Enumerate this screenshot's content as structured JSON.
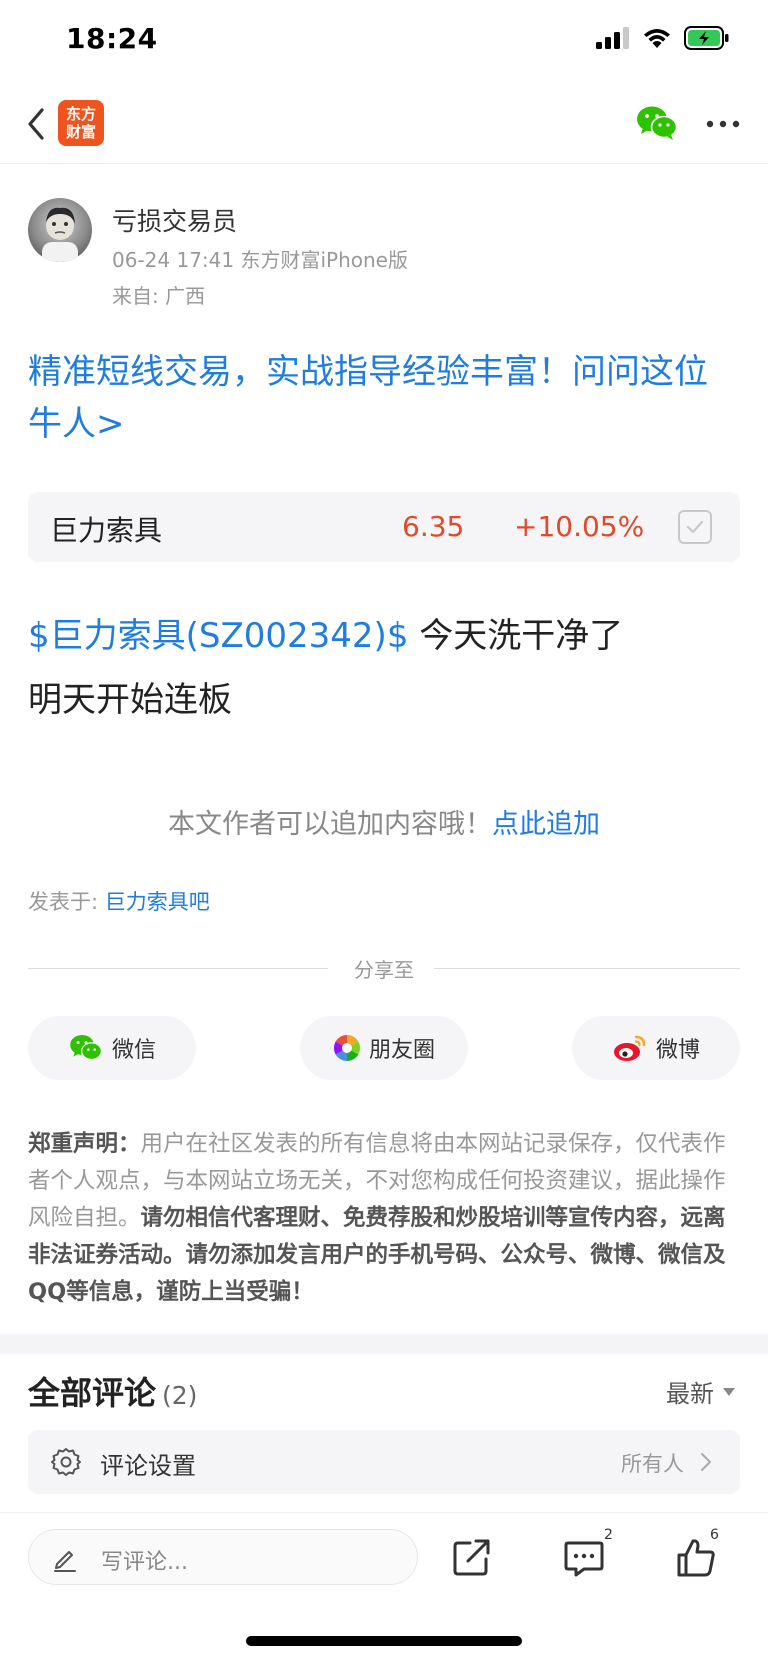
{
  "status_bar": {
    "time": "18:24"
  },
  "nav": {
    "logo_line1": "东方",
    "logo_line2": "财富"
  },
  "author": {
    "name": "亏损交易员",
    "meta": "06-24 17:41 东方财富iPhone版",
    "location": "来自: 广西"
  },
  "promo_text": "精准短线交易，实战指导经验丰富！问问这位牛人>",
  "stock": {
    "name": "巨力索具",
    "price": "6.35",
    "change": "+10.05%"
  },
  "post": {
    "stock_link": "$巨力索具(SZ002342)$",
    "line1_text": " 今天洗干净了",
    "line2_text": " 明天开始连板"
  },
  "append": {
    "hint": "本文作者可以追加内容哦！",
    "link": "点此追加"
  },
  "posted_in": {
    "label": "发表于: ",
    "bar": "巨力索具吧"
  },
  "share": {
    "label": "分享至",
    "wechat": "微信",
    "moments": "朋友圈",
    "weibo": "微博"
  },
  "disclaimer": {
    "title": "郑重声明：",
    "normal": "用户在社区发表的所有信息将由本网站记录保存，仅代表作者个人观点，与本网站立场无关，不对您构成任何投资建议，据此操作风险自担。",
    "bold": "请勿相信代客理财、免费荐股和炒股培训等宣传内容，远离非法证券活动。请勿添加发言用户的手机号码、公众号、微博、微信及QQ等信息，谨防上当受骗！"
  },
  "comments": {
    "title": "全部评论",
    "count": "(2)",
    "sort": "最新",
    "settings_label": "评论设置",
    "settings_value": "所有人"
  },
  "bottom_bar": {
    "placeholder": "写评论...",
    "comment_badge": "2",
    "like_badge": "6"
  },
  "colors": {
    "accent_blue": "#1f7ce0",
    "rise_red": "#e2492b",
    "brand_orange": "#f0541e"
  }
}
